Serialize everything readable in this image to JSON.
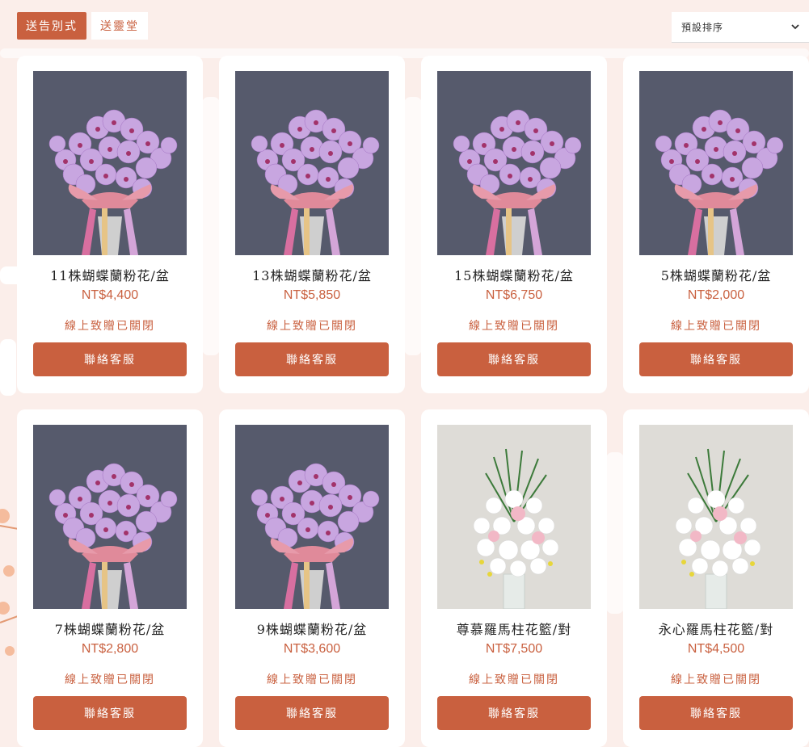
{
  "tabs": [
    {
      "label": "送告別式",
      "active": true
    },
    {
      "label": "送靈堂",
      "active": false
    }
  ],
  "sort": {
    "selected": "預設排序"
  },
  "colors": {
    "accent": "#c9603f",
    "background": "#fbeeea",
    "orchid_bg": "#565a6c",
    "wreath_bg": "#dedcd7"
  },
  "products": [
    {
      "name": "11株蝴蝶蘭粉花/盆",
      "price": "NT$4,400",
      "status": "線上致贈已關閉",
      "button": "聯絡客服",
      "image": "orchid-image"
    },
    {
      "name": "13株蝴蝶蘭粉花/盆",
      "price": "NT$5,850",
      "status": "線上致贈已關閉",
      "button": "聯絡客服",
      "image": "orchid-image"
    },
    {
      "name": "15株蝴蝶蘭粉花/盆",
      "price": "NT$6,750",
      "status": "線上致贈已關閉",
      "button": "聯絡客服",
      "image": "orchid-image"
    },
    {
      "name": "5株蝴蝶蘭粉花/盆",
      "price": "NT$2,000",
      "status": "線上致贈已關閉",
      "button": "聯絡客服",
      "image": "orchid-image"
    },
    {
      "name": "7株蝴蝶蘭粉花/盆",
      "price": "NT$2,800",
      "status": "線上致贈已關閉",
      "button": "聯絡客服",
      "image": "orchid-image"
    },
    {
      "name": "9株蝴蝶蘭粉花/盆",
      "price": "NT$3,600",
      "status": "線上致贈已關閉",
      "button": "聯絡客服",
      "image": "orchid-image"
    },
    {
      "name": "尊慕羅馬柱花籃/對",
      "price": "NT$7,500",
      "status": "線上致贈已關閉",
      "button": "聯絡客服",
      "image": "flower-stand-image"
    },
    {
      "name": "永心羅馬柱花籃/對",
      "price": "NT$4,500",
      "status": "線上致贈已關閉",
      "button": "聯絡客服",
      "image": "flower-stand-image"
    }
  ]
}
